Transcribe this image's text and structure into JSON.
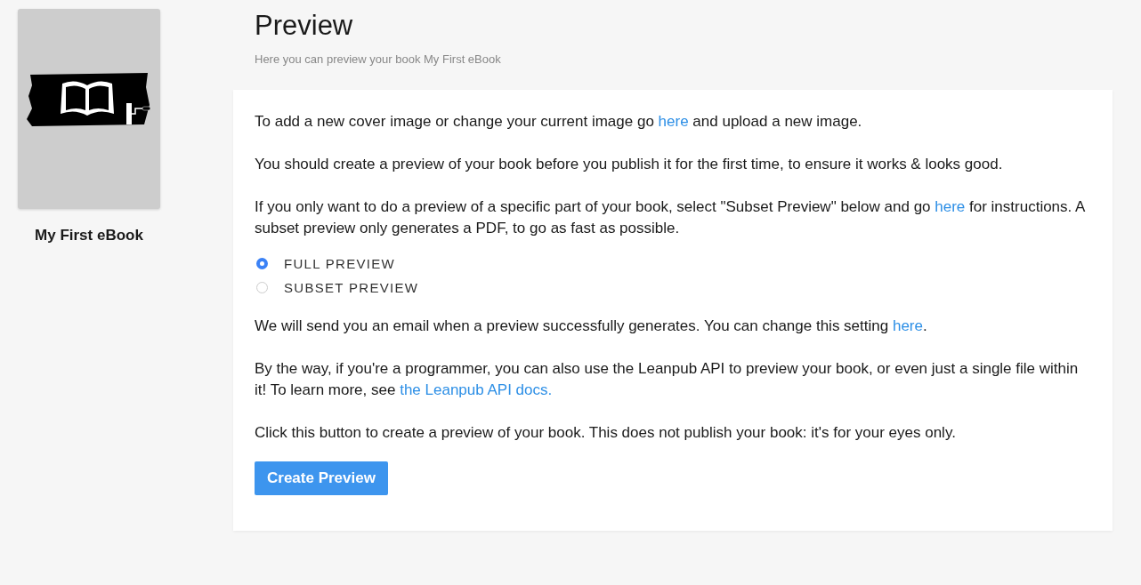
{
  "sidebar": {
    "book_title": "My First eBook"
  },
  "header": {
    "title": "Preview",
    "subtitle": "Here you can preview your book My First eBook"
  },
  "paragraphs_top": [
    [
      {
        "kind": "text",
        "text": "To add a new cover image or change your current image go "
      },
      {
        "kind": "link",
        "text": "here"
      },
      {
        "kind": "text",
        "text": " and upload a new image."
      }
    ],
    [
      {
        "kind": "text",
        "text": "You should create a preview of your book before you publish it for the first time, to ensure it works & looks good."
      }
    ],
    [
      {
        "kind": "text",
        "text": "If you only want to do a preview of a specific part of your book, select \"Subset Preview\" below and go "
      },
      {
        "kind": "link",
        "text": "here"
      },
      {
        "kind": "text",
        "text": " for instructions. A subset preview only generates a PDF, to go as fast as possible."
      }
    ]
  ],
  "options": [
    {
      "label": "FULL PREVIEW",
      "selected": true
    },
    {
      "label": "SUBSET PREVIEW",
      "selected": false
    }
  ],
  "paragraphs_bottom": [
    [
      {
        "kind": "text",
        "text": "We will send you an email when a preview successfully generates. You can change this setting "
      },
      {
        "kind": "link",
        "text": "here"
      },
      {
        "kind": "text",
        "text": "."
      }
    ],
    [
      {
        "kind": "text",
        "text": "By the way, if you're a programmer, you can also use the Leanpub API to preview your book, or even just a single file within it! To learn more, see "
      },
      {
        "kind": "link",
        "text": "the Leanpub API docs."
      }
    ],
    [
      {
        "kind": "text",
        "text": "Click this button to create a preview of your book. This does not publish your book: it's for your eyes only."
      }
    ]
  ],
  "button": "Create Preview"
}
